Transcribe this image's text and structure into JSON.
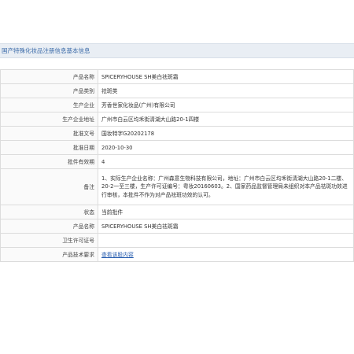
{
  "section_title": "国产特殊化妆品注册信息基本信息",
  "rows": [
    {
      "label": "产品名称",
      "value": "SPICERYHOUSE SH美白祛斑霜"
    },
    {
      "label": "产品类别",
      "value": "祛斑类"
    },
    {
      "label": "生产企业",
      "value": "芳香世家化妆品(广州)有限公司"
    },
    {
      "label": "生产企业地址",
      "value": "广州市白云区均禾街清湖大山路20-1四楼"
    },
    {
      "label": "批准文号",
      "value": "国妆特字G20202178"
    },
    {
      "label": "批准日期",
      "value": "2020-10-30"
    },
    {
      "label": "批件有效期",
      "value": "4"
    },
    {
      "label": "备注",
      "value": "1、实际生产企业名称：广州森意生物科技有限公司，地址：广州市白云区均禾街清湖大山路20-1二楼、20-2一至三楼，生产许可证编号：粤妆20160603。2、国家药品监督管理局未组织对本产品祛斑功效进行审核，本批件不作为对产品祛斑功效的认可。"
    },
    {
      "label": "状态",
      "value": "当前批件"
    },
    {
      "label": "产品名称",
      "value": "SPICERYHOUSE SH美白祛斑霜"
    },
    {
      "label": "卫生许可证号",
      "value": ""
    },
    {
      "label": "产品技术要求",
      "value": "查看该股内容"
    }
  ]
}
